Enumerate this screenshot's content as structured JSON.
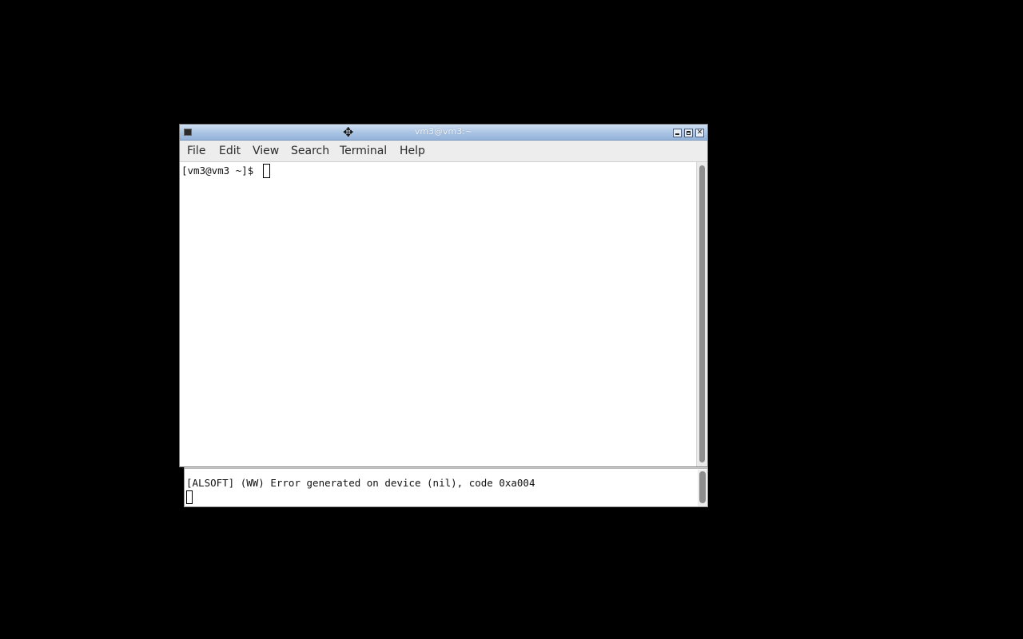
{
  "desktop": {
    "background_color": "#000000"
  },
  "terminal": {
    "title": "vm3@vm3:~",
    "icon": "terminal-icon",
    "menu": [
      "File",
      "Edit",
      "View",
      "Search",
      "Terminal",
      "Help"
    ],
    "prompt": "[vm3@vm3 ~]$ ",
    "window_buttons": [
      "minimize-icon",
      "maximize-icon",
      "close-icon"
    ],
    "titlebar_color": "#a9c3e3"
  },
  "background_terminal": {
    "output_line": "[ALSOFT] (WW) Error generated on device (nil), code 0xa004"
  },
  "pointer": {
    "icon": "move-cursor-icon"
  }
}
